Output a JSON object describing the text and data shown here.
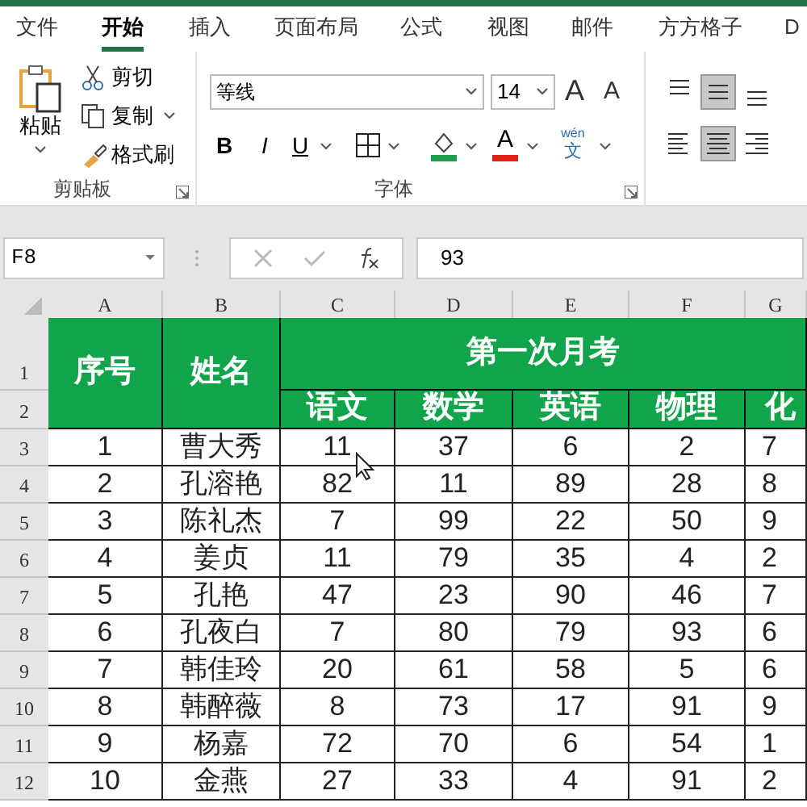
{
  "tabs": [
    {
      "label": "文件",
      "selected": false
    },
    {
      "label": "开始",
      "selected": true
    },
    {
      "label": "插入",
      "selected": false
    },
    {
      "label": "页面布局",
      "selected": false
    },
    {
      "label": "公式",
      "selected": false
    },
    {
      "label": "视图",
      "selected": false
    },
    {
      "label": "邮件",
      "selected": false
    },
    {
      "label": "方方格子",
      "selected": false
    },
    {
      "label": "D",
      "selected": false
    }
  ],
  "clipboard": {
    "paste": "粘贴",
    "cut": "剪切",
    "copy": "复制",
    "format_painter": "格式刷",
    "label": "剪贴板"
  },
  "font": {
    "name": "等线",
    "size": "14",
    "grow": "A",
    "shrink": "A",
    "bold": "B",
    "italic": "I",
    "underline": "U",
    "font_color_letter": "A",
    "phonetic_top": "wén",
    "phonetic_bottom": "文",
    "label": "字体"
  },
  "alignment": [
    {
      "kind": "top",
      "selected": false
    },
    {
      "kind": "middle",
      "selected": true
    },
    {
      "kind": "bottom",
      "selected": false
    },
    {
      "kind": "left",
      "selected": false
    },
    {
      "kind": "center",
      "selected": true
    },
    {
      "kind": "right",
      "selected": false
    }
  ],
  "formula_bar": {
    "name_box": "F8",
    "formula": "93"
  },
  "columns": [
    "A",
    "B",
    "C",
    "D",
    "E",
    "F",
    "G"
  ],
  "header_rows": [
    "1",
    "2"
  ],
  "header": {
    "seq": "序号",
    "name": "姓名",
    "group": "第一次月考",
    "subjects": [
      "语文",
      "数学",
      "英语",
      "物理",
      "化"
    ]
  },
  "rows": [
    {
      "n": "3",
      "cells": [
        "1",
        "曹大秀",
        "11",
        "37",
        "6",
        "2",
        "7"
      ]
    },
    {
      "n": "4",
      "cells": [
        "2",
        "孔溶艳",
        "82",
        "11",
        "89",
        "28",
        "8"
      ]
    },
    {
      "n": "5",
      "cells": [
        "3",
        "陈礼杰",
        "7",
        "99",
        "22",
        "50",
        "9"
      ]
    },
    {
      "n": "6",
      "cells": [
        "4",
        "姜贞",
        "11",
        "79",
        "35",
        "4",
        "2"
      ]
    },
    {
      "n": "7",
      "cells": [
        "5",
        "孔艳",
        "47",
        "23",
        "90",
        "46",
        "7"
      ]
    },
    {
      "n": "8",
      "cells": [
        "6",
        "孔夜白",
        "7",
        "80",
        "79",
        "93",
        "6"
      ]
    },
    {
      "n": "9",
      "cells": [
        "7",
        "韩佳玲",
        "20",
        "61",
        "58",
        "5",
        "6"
      ]
    },
    {
      "n": "10",
      "cells": [
        "8",
        "韩醉薇",
        "8",
        "73",
        "17",
        "91",
        "9"
      ]
    },
    {
      "n": "11",
      "cells": [
        "9",
        "杨嘉",
        "72",
        "70",
        "6",
        "54",
        "1"
      ]
    },
    {
      "n": "12",
      "cells": [
        "10",
        "金燕",
        "27",
        "33",
        "4",
        "91",
        "2"
      ]
    }
  ]
}
